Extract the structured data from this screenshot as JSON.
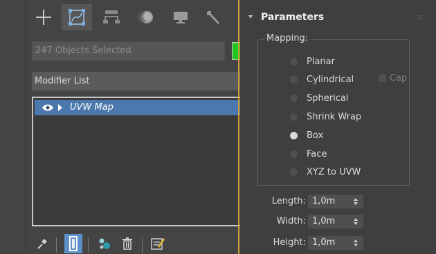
{
  "command_panel": {
    "tabs": [
      {
        "name": "create",
        "icon": "plus-icon"
      },
      {
        "name": "modify",
        "icon": "modify-curve-icon",
        "active": true
      },
      {
        "name": "hierarchy",
        "icon": "hierarchy-icon"
      },
      {
        "name": "motion",
        "icon": "motion-sphere-icon"
      },
      {
        "name": "display",
        "icon": "monitor-icon"
      },
      {
        "name": "utilities",
        "icon": "wrench-icon"
      }
    ],
    "selection_text": "247 Objects Selected",
    "selection_color": "#1fc61f",
    "modifier_list_label": "Modifier List",
    "stack_items": [
      {
        "label": "UVW Map",
        "selected": true
      }
    ],
    "bottom_icons": [
      "pin-stack-icon",
      "show-end-result-icon",
      "make-unique-icon",
      "remove-modifier-icon",
      "configure-modifier-sets-icon"
    ]
  },
  "parameters": {
    "title": "Parameters",
    "mapping_label": "Mapping:",
    "options": [
      {
        "label": "Planar",
        "checked": false
      },
      {
        "label": "Cylindrical",
        "checked": false
      },
      {
        "label": "Spherical",
        "checked": false
      },
      {
        "label": "Shrink Wrap",
        "checked": false
      },
      {
        "label": "Box",
        "checked": true
      },
      {
        "label": "Face",
        "checked": false
      },
      {
        "label": "XYZ to UVW",
        "checked": false
      }
    ],
    "cap_label": "Cap",
    "length_label": "Length:",
    "length_value": "1,0m",
    "width_label": "Width:",
    "width_value": "1,0m",
    "height_label": "Height:",
    "height_value": "1,0m"
  },
  "colors": {
    "accent_gold": "#d19d35",
    "selection_blue": "#4c79ad"
  }
}
